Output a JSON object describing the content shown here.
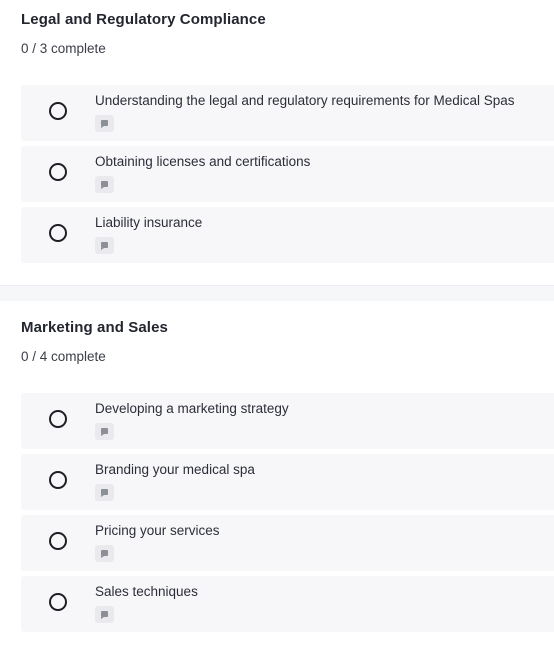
{
  "sections": [
    {
      "title": "Legal and Regulatory Compliance",
      "progress": "0 / 3 complete",
      "lessons": [
        {
          "title": "Understanding the legal and regulatory requirements for Medical Spas",
          "type_icon": "text-lesson-icon",
          "completed": false
        },
        {
          "title": "Obtaining licenses and certifications",
          "type_icon": "text-lesson-icon",
          "completed": false
        },
        {
          "title": "Liability insurance",
          "type_icon": "text-lesson-icon",
          "completed": false
        }
      ]
    },
    {
      "title": "Marketing and Sales",
      "progress": "0 / 4 complete",
      "lessons": [
        {
          "title": "Developing a marketing strategy",
          "type_icon": "text-lesson-icon",
          "completed": false
        },
        {
          "title": "Branding your medical spa",
          "type_icon": "text-lesson-icon",
          "completed": false
        },
        {
          "title": "Pricing your services",
          "type_icon": "text-lesson-icon",
          "completed": false
        },
        {
          "title": "Sales techniques",
          "type_icon": "text-lesson-icon",
          "completed": false
        }
      ]
    }
  ],
  "colors": {
    "row_background": "#f7f7f9",
    "section_divider": "#f6f7f9",
    "badge_background": "#e9e9ee",
    "badge_glyph": "#8d8f98",
    "circle_stroke": "#1e1f24"
  }
}
